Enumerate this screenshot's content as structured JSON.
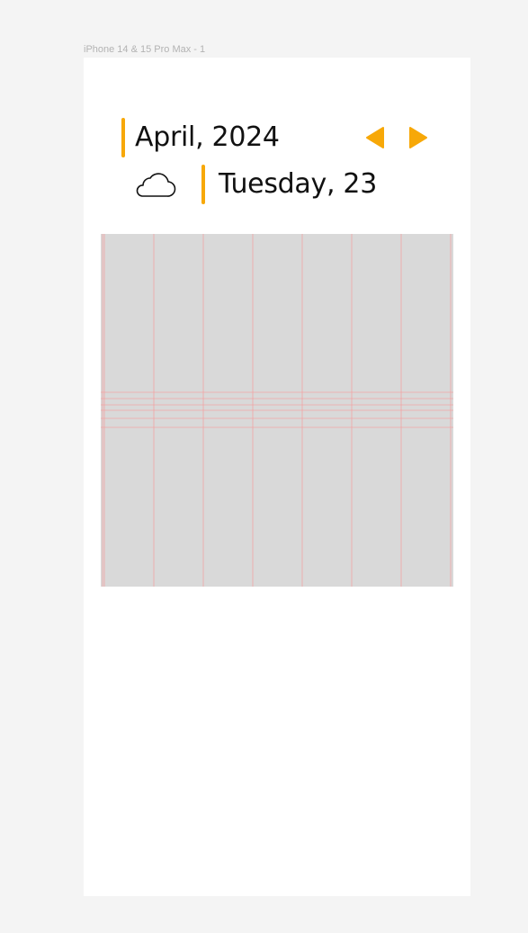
{
  "frame": {
    "label": "iPhone 14 & 15 Pro Max - 1"
  },
  "header": {
    "month_year": "April, 2024",
    "day_label": "Tuesday, 23",
    "prev_icon": "triangle-left-icon",
    "next_icon": "triangle-right-icon",
    "weather_icon": "cloud-icon"
  },
  "colors": {
    "accent": "#f7a808",
    "background": "#ffffff",
    "canvas": "#f4f4f4",
    "placeholder": "#d9d9d9",
    "grid_line": "#f2a5a5"
  }
}
